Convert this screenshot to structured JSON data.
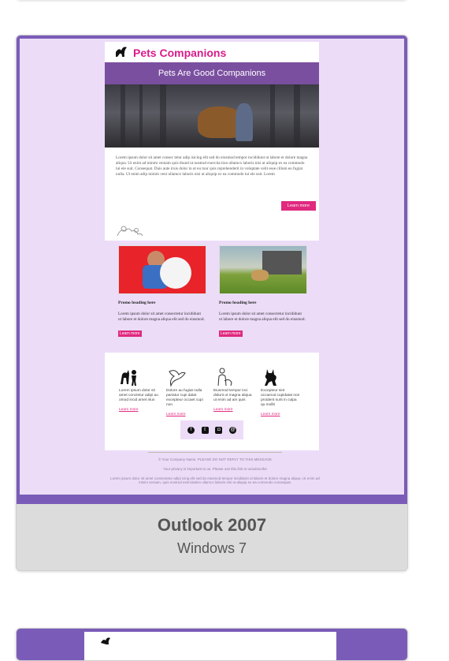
{
  "email": {
    "brand": "Pets Companions",
    "banner_title": "Pets Are Good Companions",
    "intro": "Lorem ipsum dolor sit amet consec tetur adip isicing elit sed do eiusmod tempor incididunt ut labore et dolore magna aliqua. Ut enim ad minim veniam quis thund ut nostrud exercita tion ullamco laboris nisi ut aliquip ex ea commodo tui ele suit. Consequat. Duis aute iruis dolor in ut eu tour quis reprehenderit in voluptate velit esse cillum eu fugiat nulla. Ut enim adip minim veni ullamco laboris nisi ut aliquip ex ea commodo tui ele suit. Lorem",
    "learn_more": "Learn more",
    "promos": [
      {
        "heading": "Promo heading here",
        "text": "Lorem ipsum dolor sit amet consectetur incididunt ut labore et dolore magna aliqua elit sed do eiusmod.",
        "link": "Learn more"
      },
      {
        "heading": "Promo heading here",
        "text": "Lorem ipsum dolor sit amet consectetur incididunt ut labore et dolore magna aliqua elit sed do eiusmod.",
        "link": "Learn more"
      }
    ],
    "columns": [
      {
        "icon": "dog-child-icon",
        "text": "Lorem ipsum dolor sit amet conctetur adipi au omod incid amet nlun",
        "link": "Learn more"
      },
      {
        "icon": "bird-icon",
        "text": "Dolore au fugiat nulla pariatur cupi datat excepteur occaet cupi non",
        "link": "Learn more"
      },
      {
        "icon": "person-pet-icon",
        "text": "Eiusmod tempor inci didunt ut magna aliqua ut enim ad am quis",
        "link": "Learn more"
      },
      {
        "icon": "cat-icon",
        "text": "Excepteur sint occaecat cupidatat non proident sunt in culpa qu mollit",
        "link": "Learn more"
      }
    ],
    "social": [
      "facebook-icon",
      "twitter-icon",
      "instagram-icon",
      "email-icon"
    ],
    "footer": {
      "line1": "© Your Company Name. PLEASE DO NOT REPLY TO THIS MESSAGE",
      "line2": "Your privacy is important to us. Please use this link to unsubscribe",
      "line3": "Lorem ipsum dolor sit amet consectetur adipi icing elit sed do eiusmod tempor incididunt ut labore et dolore magna aliqua. Ut enim ad minim veniam, quis nostrud exercitation ullamco laboris nisi ut aliquip ex ea commodo consequat."
    }
  },
  "caption": {
    "title": "Outlook 2007",
    "subtitle": "Windows 7"
  },
  "colors": {
    "frame": "#7a5cb8",
    "accent": "#e0287f",
    "banner": "#7a4fa0",
    "background": "#ecdcf8"
  }
}
